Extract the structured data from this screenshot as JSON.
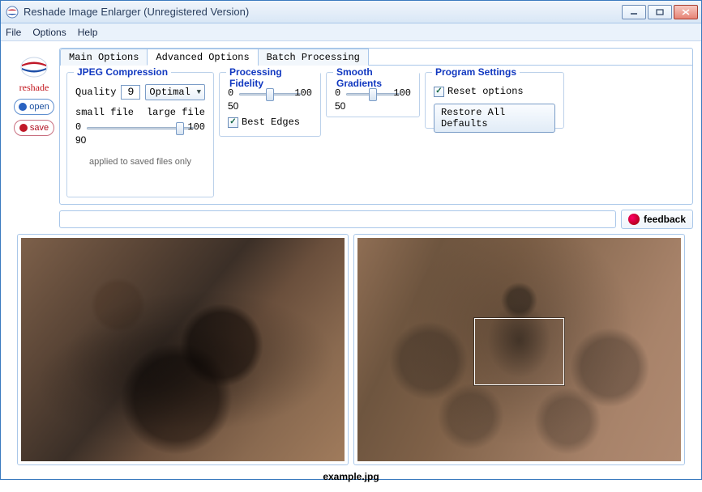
{
  "window": {
    "title": "Reshade Image Enlarger (Unregistered Version)"
  },
  "menu": {
    "file": "File",
    "options": "Options",
    "help": "Help"
  },
  "brand": {
    "name": "reshade"
  },
  "sidebar": {
    "open": "open",
    "save": "save"
  },
  "tabs": {
    "main": "Main Options",
    "advanced": "Advanced Options",
    "batch": "Batch Processing",
    "active": "advanced"
  },
  "jpeg": {
    "legend": "JPEG Compression",
    "quality_label": "Quality",
    "quality_value": "9",
    "preset": "Optimal",
    "small_label": "small file",
    "large_label": "large file",
    "slider_min": "0",
    "slider_max": "100",
    "slider_value": "90",
    "hint": "applied to saved files only"
  },
  "fidelity": {
    "legend": "Processing Fidelity",
    "slider_min": "0",
    "slider_max": "100",
    "slider_value": "50",
    "best_edges": "Best Edges"
  },
  "smooth": {
    "legend": "Smooth Gradients",
    "slider_min": "0",
    "slider_max": "100",
    "slider_value": "50"
  },
  "settings": {
    "legend": "Program Settings",
    "reset": "Reset options",
    "restore": "Restore All Defaults"
  },
  "feedback": {
    "label": "feedback"
  },
  "file": {
    "name": "example.jpg"
  }
}
